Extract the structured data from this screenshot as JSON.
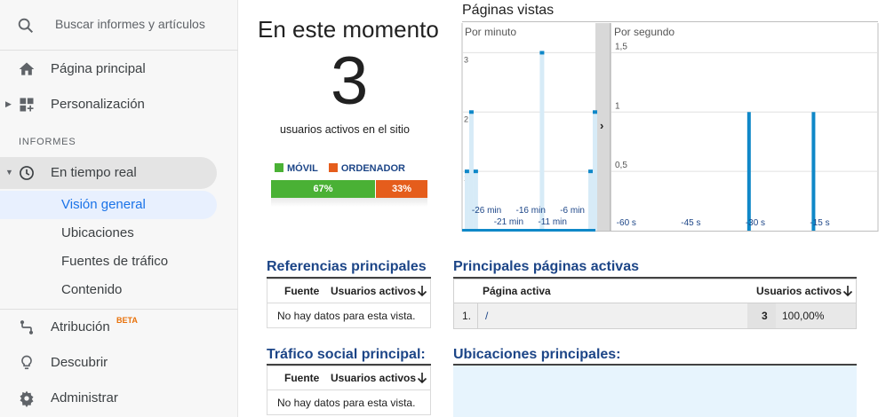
{
  "sidebar": {
    "search_placeholder": "Buscar informes y artículos",
    "home": "Página principal",
    "custom": "Personalización",
    "section": "INFORMES",
    "realtime": "En tiempo real",
    "realtime_sub": [
      "Visión general",
      "Ubicaciones",
      "Fuentes de tráfico",
      "Contenido"
    ],
    "attribution": "Atribución",
    "beta": "BETA",
    "discover": "Descubrir",
    "admin": "Administrar"
  },
  "now": {
    "title": "En este momento",
    "count": "3",
    "subtitle": "usuarios activos en el sitio",
    "legend_mobile": "MÓVIL",
    "legend_desktop": "ORDENADOR",
    "mobile_pct": "67%",
    "desktop_pct": "33%",
    "mobile_share": 0.67,
    "colors": {
      "mobile": "#4ab135",
      "desktop": "#e55d1c"
    }
  },
  "pageviews": {
    "title": "Páginas vistas",
    "per_minute": "Por minuto",
    "per_second": "Por segundo"
  },
  "chart_data": [
    {
      "type": "bar",
      "title": "Por minuto",
      "ylim": [
        0,
        3.5
      ],
      "y_ticks": [
        "1",
        "2",
        "3"
      ],
      "x_ticks_top": [
        "-26 min",
        "-16 min",
        "-6 min"
      ],
      "x_ticks_bottom": [
        "-21 min",
        "-11 min"
      ],
      "bars": [
        {
          "x": -29,
          "value": 1
        },
        {
          "x": -28,
          "value": 2
        },
        {
          "x": -27,
          "value": 1
        },
        {
          "x": -12,
          "value": 3
        },
        {
          "x": -1,
          "value": 1
        },
        {
          "x": 0,
          "value": 2
        }
      ]
    },
    {
      "type": "bar",
      "title": "Por segundo",
      "ylim": [
        0,
        1.75
      ],
      "y_ticks": [
        "0,5",
        "1",
        "1,5"
      ],
      "x_ticks": [
        "-60 s",
        "-45 s",
        "-30 s",
        "-15 s"
      ],
      "bars": [
        {
          "x": -30,
          "value": 1
        },
        {
          "x": -15,
          "value": 1
        }
      ]
    }
  ],
  "referrals": {
    "title": "Referencias principales",
    "col1": "Fuente",
    "col2": "Usuarios activos",
    "empty": "No hay datos para esta vista."
  },
  "social": {
    "title": "Tráfico social principal:",
    "col1": "Fuente",
    "col2": "Usuarios activos",
    "empty": "No hay datos para esta vista."
  },
  "active_pages": {
    "title": "Principales páginas activas",
    "col1": "Página activa",
    "col2": "Usuarios activos",
    "rows": [
      {
        "index": "1.",
        "page": "/",
        "users": "3",
        "pct": "100,00%"
      }
    ]
  },
  "locations": {
    "title": "Ubicaciones principales:"
  },
  "icons": [
    "search-icon",
    "home-icon",
    "dashboard-icon",
    "clock-icon",
    "attribution-icon",
    "lightbulb-icon",
    "gear-icon",
    "sort-down-icon",
    "chevron-right-icon"
  ]
}
